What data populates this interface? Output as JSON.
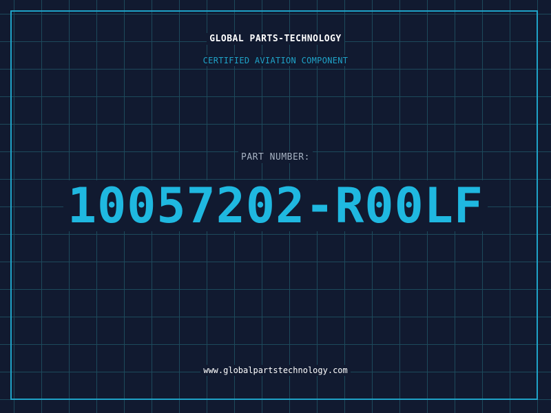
{
  "header": {
    "company_name": "GLOBAL PARTS-TECHNOLOGY",
    "subtitle": "CERTIFIED AVIATION COMPONENT"
  },
  "part": {
    "label": "PART NUMBER:",
    "number": "10057202-R00LF"
  },
  "footer": {
    "website": "www.globalpartstechnology.com"
  },
  "colors": {
    "background": "#111a30",
    "grid": "#1d4a5c",
    "accent": "#1fa3c8",
    "part_number": "#1fb8e0",
    "label": "#a7b2c2",
    "text": "#ffffff"
  }
}
